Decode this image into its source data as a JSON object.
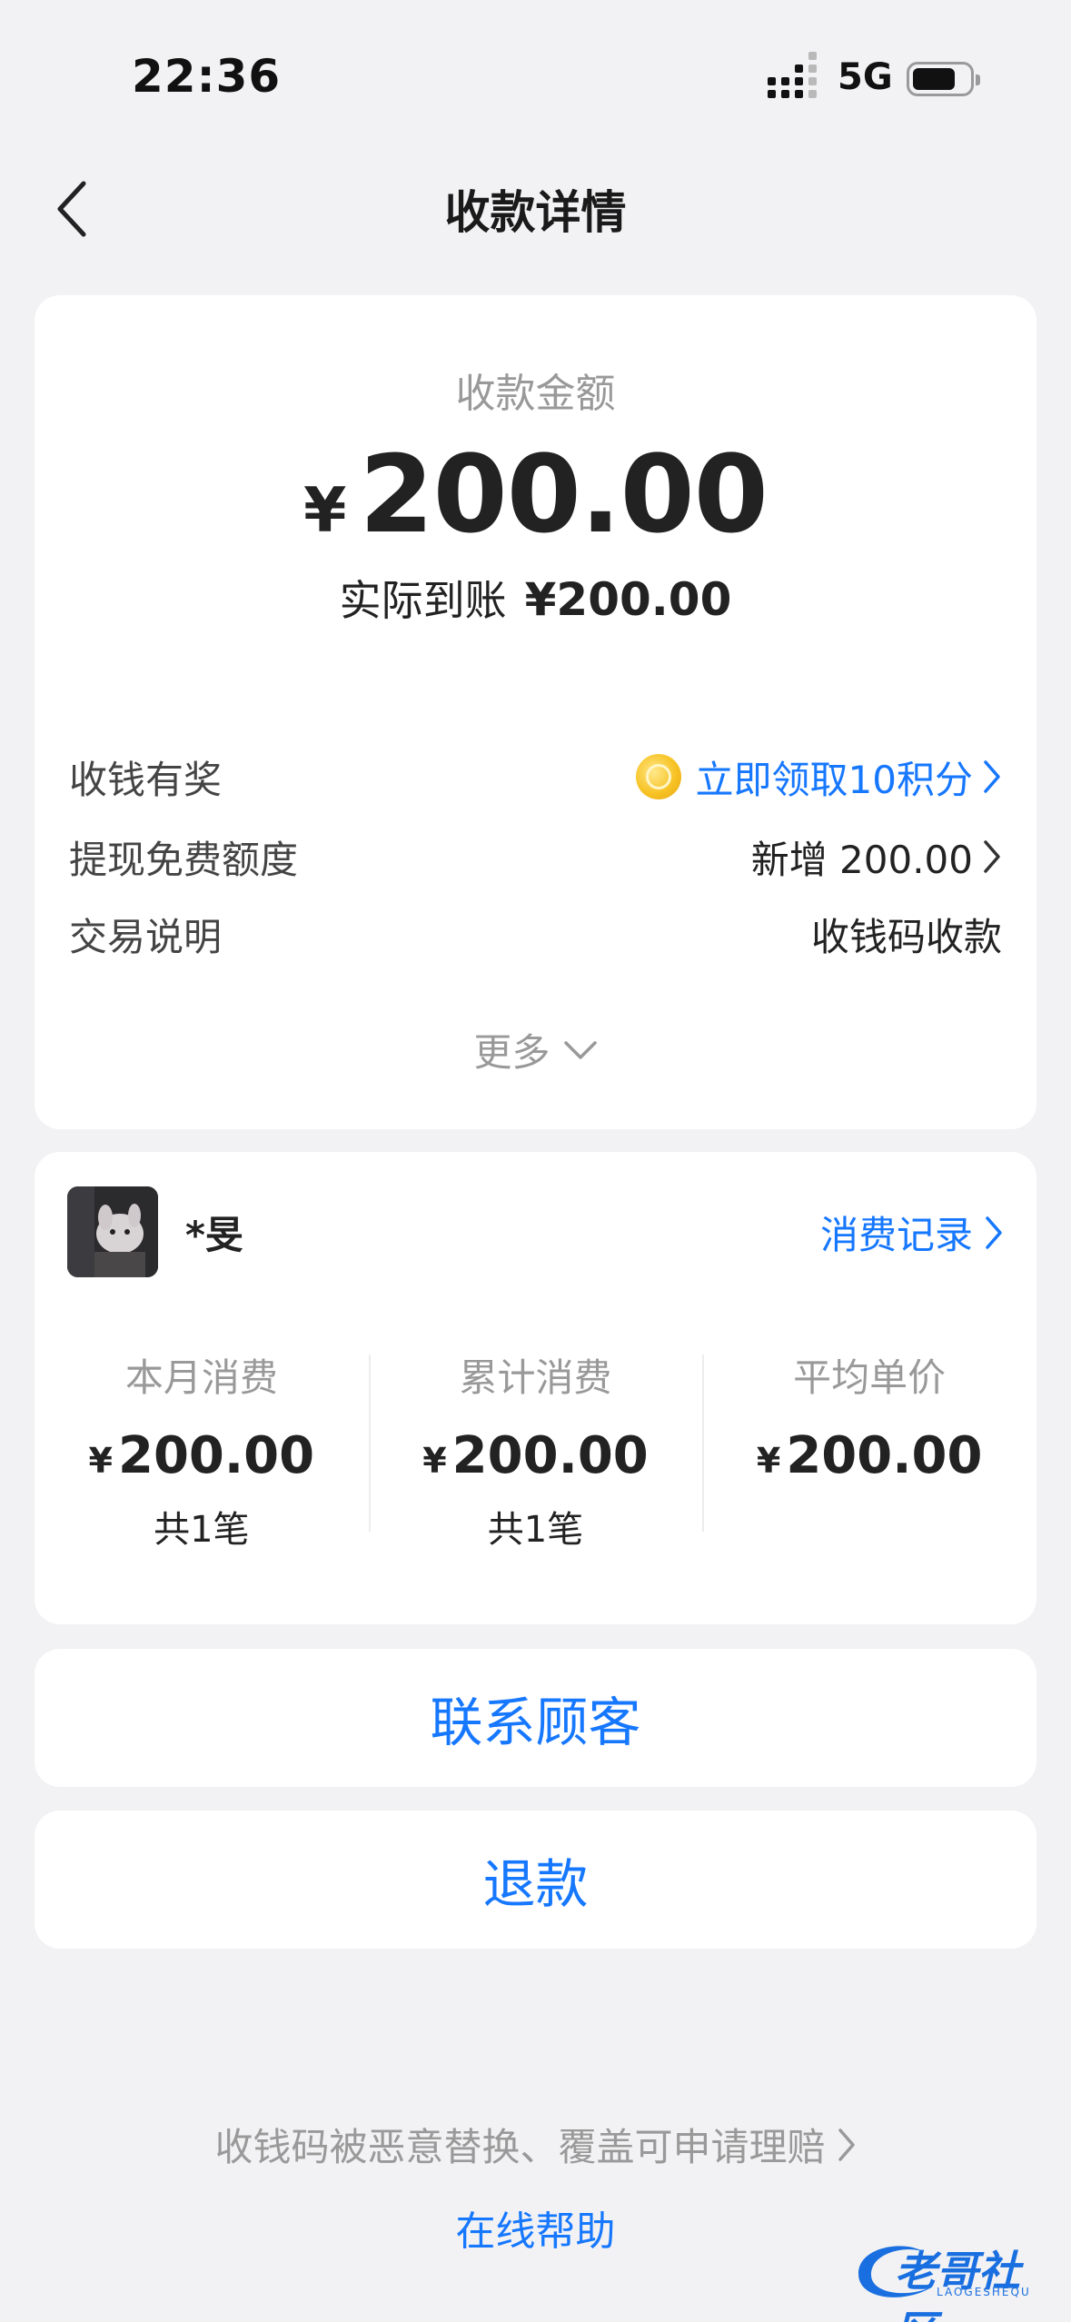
{
  "status_bar": {
    "time": "22:36",
    "network": "5G"
  },
  "nav": {
    "title": "收款详情"
  },
  "payment": {
    "amount_label": "收款金额",
    "currency": "¥",
    "amount": "200.00",
    "received_label": "实际到账",
    "received_value": "¥200.00"
  },
  "details": [
    {
      "label": "收钱有奖",
      "value": "立即领取10积分"
    },
    {
      "label": "提现免费额度",
      "value": "新增 200.00"
    },
    {
      "label": "交易说明",
      "value": "收钱码收款"
    }
  ],
  "more_label": "更多",
  "customer": {
    "name": "*旻",
    "records_link": "消费记录",
    "stats": [
      {
        "label": "本月消费",
        "currency": "¥",
        "value": "200.00",
        "count": "共1笔"
      },
      {
        "label": "累计消费",
        "currency": "¥",
        "value": "200.00",
        "count": "共1笔"
      },
      {
        "label": "平均单价",
        "currency": "¥",
        "value": "200.00",
        "count": ""
      }
    ]
  },
  "actions": {
    "contact": "联系顾客",
    "refund": "退款"
  },
  "footer": {
    "claim_text": "收钱码被恶意替换、覆盖可申请理赔",
    "help_link": "在线帮助"
  },
  "watermark": {
    "text": "老哥社区",
    "sub": "LAOGESHEQU"
  },
  "colors": {
    "accent": "#1677ff",
    "background": "#f2f2f4",
    "muted": "#999999"
  }
}
